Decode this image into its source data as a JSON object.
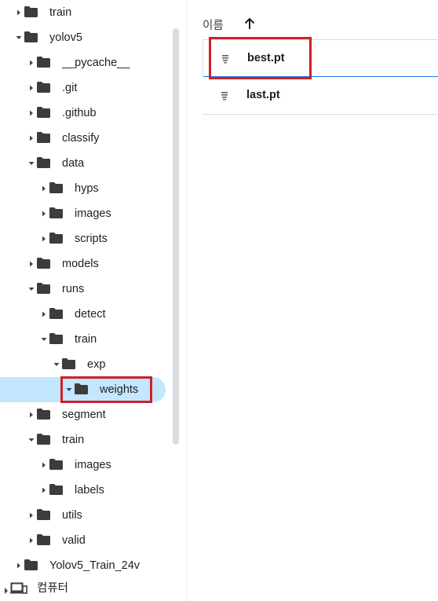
{
  "tree": {
    "items": [
      {
        "label": "train",
        "depth": 1,
        "expanded": false
      },
      {
        "label": "yolov5",
        "depth": 1,
        "expanded": true
      },
      {
        "label": "__pycache__",
        "depth": 2,
        "expanded": false
      },
      {
        "label": ".git",
        "depth": 2,
        "expanded": false
      },
      {
        "label": ".github",
        "depth": 2,
        "expanded": false
      },
      {
        "label": "classify",
        "depth": 2,
        "expanded": false
      },
      {
        "label": "data",
        "depth": 2,
        "expanded": true
      },
      {
        "label": "hyps",
        "depth": 3,
        "expanded": false
      },
      {
        "label": "images",
        "depth": 3,
        "expanded": false
      },
      {
        "label": "scripts",
        "depth": 3,
        "expanded": false
      },
      {
        "label": "models",
        "depth": 2,
        "expanded": false
      },
      {
        "label": "runs",
        "depth": 2,
        "expanded": true
      },
      {
        "label": "detect",
        "depth": 3,
        "expanded": false
      },
      {
        "label": "train",
        "depth": 3,
        "expanded": true
      },
      {
        "label": "exp",
        "depth": 4,
        "expanded": true
      },
      {
        "label": "weights",
        "depth": 5,
        "expanded": true,
        "selected": true
      },
      {
        "label": "segment",
        "depth": 2,
        "expanded": false
      },
      {
        "label": "train",
        "depth": 2,
        "expanded": true
      },
      {
        "label": "images",
        "depth": 3,
        "expanded": false
      },
      {
        "label": "labels",
        "depth": 3,
        "expanded": false
      },
      {
        "label": "utils",
        "depth": 2,
        "expanded": false
      },
      {
        "label": "valid",
        "depth": 2,
        "expanded": false
      },
      {
        "label": "Yolov5_Train_24v",
        "depth": 1,
        "expanded": false
      }
    ],
    "computer_label": "컴퓨터"
  },
  "files": {
    "header_name": "이름",
    "sort_icon": "arrow-up-icon",
    "rows": [
      {
        "name": "best.pt",
        "icon": "file-lines-icon",
        "highlighted": true
      },
      {
        "name": "last.pt",
        "icon": "file-lines-icon",
        "highlighted": false
      }
    ]
  },
  "colors": {
    "selected_bg": "#c2e7ff",
    "highlight_border": "#d21f26",
    "folder": "#3c3c3c",
    "focus_line": "#1a73e8"
  }
}
